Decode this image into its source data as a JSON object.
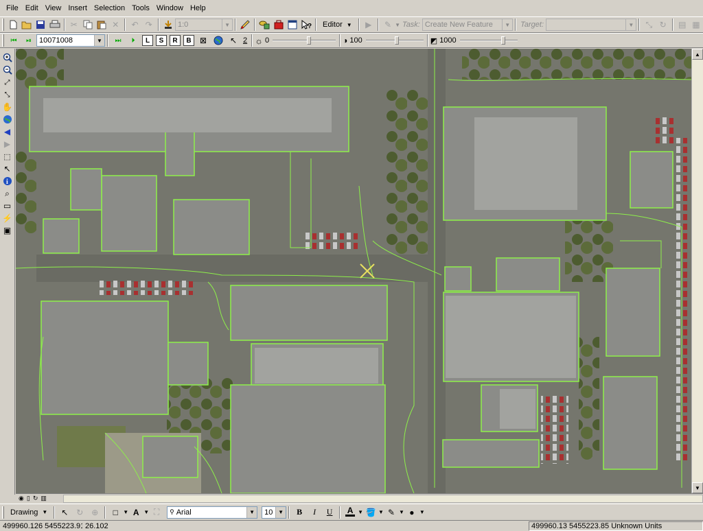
{
  "menu": [
    "File",
    "Edit",
    "View",
    "Insert",
    "Selection",
    "Tools",
    "Window",
    "Help"
  ],
  "toolbar": {
    "scale_value": "1:0",
    "editor_label": "Editor",
    "task_label": "Task:",
    "task_value": "Create New Feature",
    "target_label": "Target:",
    "target_value": ""
  },
  "imagery_toolbar": {
    "image_id": "10071008",
    "page_number": "2",
    "brightness_value": "0",
    "contrast_value": "100",
    "transparency_value": "1000",
    "letter_buttons": [
      "L",
      "S",
      "R",
      "B"
    ]
  },
  "drawing_toolbar": {
    "drawing_label": "Drawing",
    "font_name": "Arial",
    "font_size": "10",
    "bold": "B",
    "italic": "I",
    "underline": "U",
    "font_color_glyph": "A"
  },
  "status": {
    "coords": "499960.126  5455223.915",
    "value": "26.102",
    "coords_units": "499960.13  5455223.85 Unknown Units"
  },
  "colors": {
    "outline": "#8ef04a",
    "building_roof": "#8b8c88",
    "pavement": "#707168",
    "tree": "#5c6b3a"
  },
  "icons": [
    "new-icon",
    "open-icon",
    "save-icon",
    "print-icon",
    "cut-icon",
    "copy-icon",
    "paste-icon",
    "delete-icon",
    "undo-icon",
    "redo-icon",
    "add-data-icon",
    "editor-icon",
    "arccatalog-icon",
    "arctoolbox-icon",
    "whats-this-icon",
    "zoom-in-icon",
    "zoom-out-icon",
    "pan-icon",
    "globe-icon",
    "back-icon",
    "forward-icon",
    "select-icon",
    "identify-icon",
    "find-icon",
    "measure-icon",
    "hyperlink-icon",
    "pointer-icon",
    "bold-icon"
  ]
}
